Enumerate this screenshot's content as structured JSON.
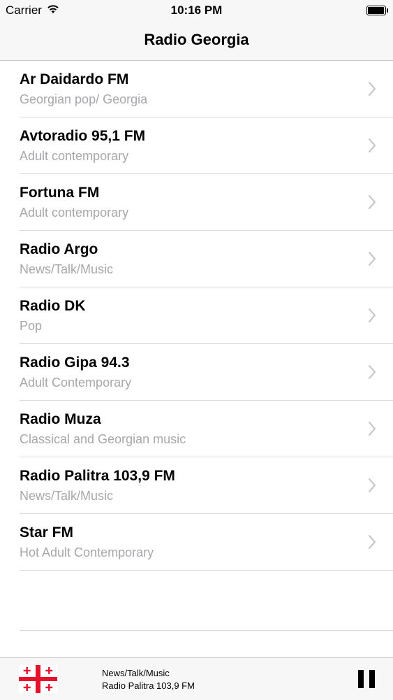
{
  "status_bar": {
    "carrier": "Carrier",
    "time": "10:16 PM",
    "wifi_icon": "wifi-icon",
    "battery_icon": "battery-icon"
  },
  "nav": {
    "title": "Radio Georgia"
  },
  "stations": [
    {
      "name": "Ar Daidardo FM",
      "genre": "Georgian pop/ Georgia"
    },
    {
      "name": "Avtoradio 95,1 FM",
      "genre": "Adult contemporary"
    },
    {
      "name": "Fortuna FM",
      "genre": "Adult contemporary"
    },
    {
      "name": "Radio Argo",
      "genre": "News/Talk/Music"
    },
    {
      "name": "Radio DK",
      "genre": "Pop"
    },
    {
      "name": "Radio Gipa 94.3",
      "genre": "Adult Contemporary"
    },
    {
      "name": "Radio Muza",
      "genre": "Classical and Georgian music"
    },
    {
      "name": "Radio Palitra 103,9 FM",
      "genre": "News/Talk/Music"
    },
    {
      "name": "Star FM",
      "genre": "Hot Adult Contemporary"
    }
  ],
  "player": {
    "genre": "News/Talk/Music",
    "station": "Radio Palitra 103,9 FM",
    "flag_icon": "georgia-flag-icon",
    "control_icon": "pause-icon"
  },
  "colors": {
    "background": "#ffffff",
    "bar_background": "#f7f7f7",
    "subtitle_gray": "#a7a7ac",
    "chevron_gray": "#c7c7cc",
    "flag_red": "#e8112d"
  }
}
